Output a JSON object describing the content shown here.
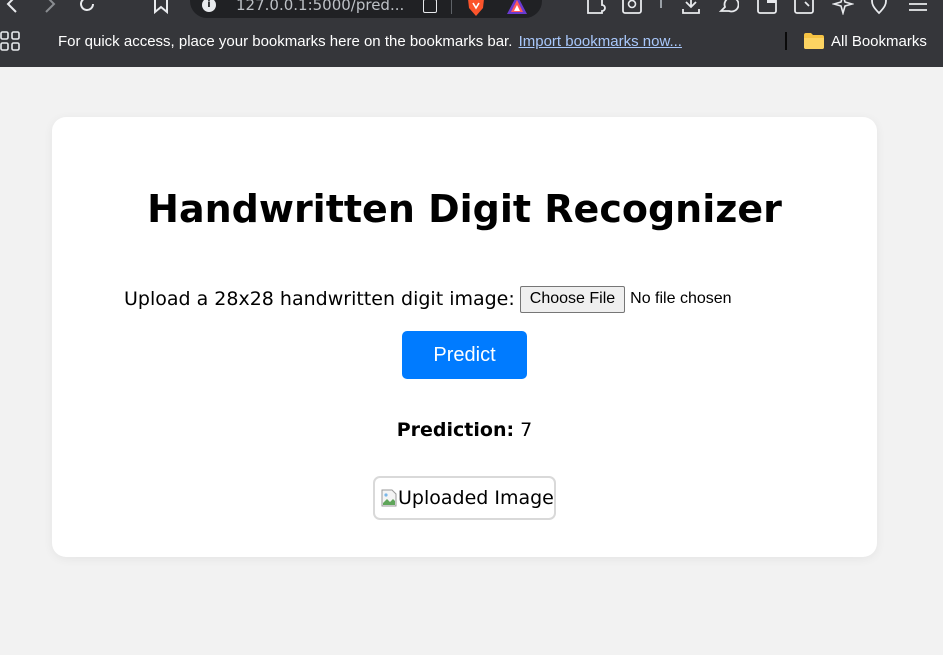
{
  "browser": {
    "address_bar": {
      "url": "127.0.0.1:5000/pred..."
    },
    "toolbar_icons": [
      "back-icon",
      "forward-icon",
      "reload-icon",
      "bookmark-star-icon",
      "info-icon",
      "share-icon",
      "brave-shields-icon",
      "brave-rewards-icon",
      "extensions-icon",
      "search-tabs-icon",
      "download-icon",
      "leo-icon",
      "wallet-icon",
      "sidebar-icon",
      "ai-icon",
      "vpn-icon",
      "menu-icon"
    ],
    "bookmarks_bar": {
      "message": "For quick access, place your bookmarks here on the bookmarks bar.",
      "import_link": "Import bookmarks now...",
      "all_bookmarks": "All Bookmarks"
    }
  },
  "page": {
    "title": "Handwritten Digit Recognizer",
    "upload": {
      "label": "Upload a 28x28 handwritten digit image:",
      "button": "Choose File",
      "status": "No file chosen"
    },
    "predict_button": "Predict",
    "prediction": {
      "label": "Prediction:",
      "value": "7"
    },
    "uploaded_image_alt": "Uploaded Image"
  },
  "colors": {
    "browser_chrome": "#35363a",
    "page_background": "#f2f2f2",
    "card_background": "#ffffff",
    "predict_button": "#007bff",
    "bookmark_link": "#a8c7fa"
  }
}
